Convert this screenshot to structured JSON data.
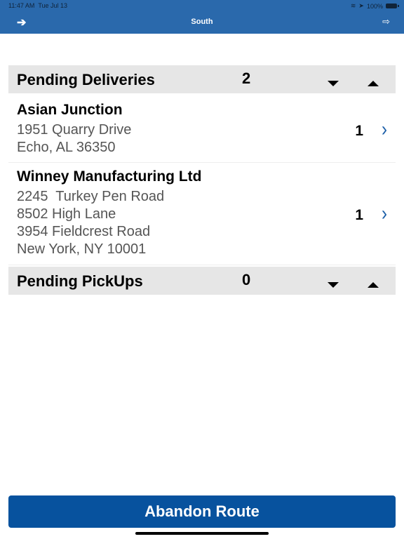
{
  "status_bar": {
    "time": "11:47 AM",
    "date": "Tue Jul 13",
    "battery": "100%"
  },
  "header": {
    "title": "South",
    "back_icon": "arrow-left-icon",
    "logout_icon": "sign-out-icon"
  },
  "sections": [
    {
      "title": "Pending Deliveries",
      "count": "2",
      "items": [
        {
          "name": "Asian Junction",
          "address": "1951 Quarry Drive\nEcho, AL 36350",
          "qty": "1"
        },
        {
          "name": "Winney Manufacturing Ltd",
          "address": "2245  Turkey Pen Road\n8502 High Lane\n3954 Fieldcrest Road\nNew York, NY 10001",
          "qty": "1"
        }
      ]
    },
    {
      "title": "Pending PickUps",
      "count": "0",
      "items": []
    }
  ],
  "footer": {
    "abandon_label": "Abandon Route"
  },
  "chevron_glyph": "›",
  "colors": {
    "nav": "#2a69ac",
    "button": "#07529e",
    "chevron": "#1c5fa8"
  }
}
